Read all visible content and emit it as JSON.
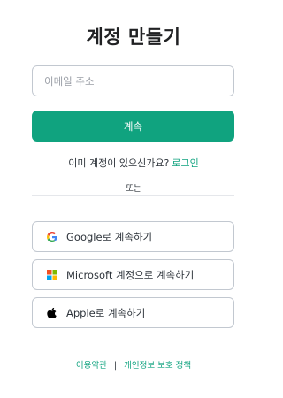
{
  "header": {
    "title": "계정 만들기"
  },
  "form": {
    "email_placeholder": "이메일 주소",
    "email_value": "",
    "continue_label": "계속"
  },
  "login_prompt": {
    "text": "이미 계정이 있으신가요?",
    "link_label": "로그인"
  },
  "divider_label": "또는",
  "social": [
    {
      "label": "Google로 계속하기",
      "icon": "google-icon"
    },
    {
      "label": "Microsoft 계정으로 계속하기",
      "icon": "microsoft-icon"
    },
    {
      "label": "Apple로 계속하기",
      "icon": "apple-icon"
    }
  ],
  "footer": {
    "terms_label": "이용약관",
    "separator": "|",
    "privacy_label": "개인정보 보호 정책"
  },
  "colors": {
    "accent": "#10a37f",
    "border": "#c2c8d0",
    "text": "#202123"
  }
}
